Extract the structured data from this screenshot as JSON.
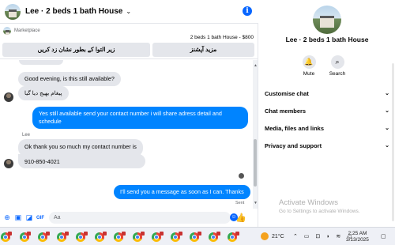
{
  "header": {
    "title": "Lee · 2 beds 1 bath House",
    "chevron": "⌄",
    "info_icon": "i"
  },
  "marketplace": {
    "label": "Marketplace",
    "listing": "2 beds 1 bath House - $800",
    "left_button": "زیر التوا کے بطور نشان زد کریں",
    "right_button": "مزید آپشنز"
  },
  "messages": [
    {
      "text": "Good evening, is this still available?"
    },
    {
      "text": "پیغام بھیج دیا گیا"
    },
    {
      "text": "Yes still available send your contact number i will share adress detail and schedule"
    },
    {
      "sender": "Lee",
      "text": "Ok thank you so much my contact number is"
    },
    {
      "text": "910-850-4021"
    },
    {
      "text": "I'll send you a message as soon as I can. Thanks",
      "status": "Sent"
    }
  ],
  "composer": {
    "placeholder": "Aa"
  },
  "sidebar": {
    "title": "Lee · 2 beds 1 bath House",
    "mute_label": "Mute",
    "search_label": "Search",
    "rows": [
      "Customise chat",
      "Chat members",
      "Media, files and links",
      "Privacy and support"
    ],
    "chevron": "⌄"
  },
  "watermark": {
    "title": "Activate Windows",
    "subtitle": "Go to Settings to activate Windows."
  },
  "taskbar": {
    "temperature": "21°C",
    "time": "2:25 AM",
    "date": "3/13/2025"
  }
}
